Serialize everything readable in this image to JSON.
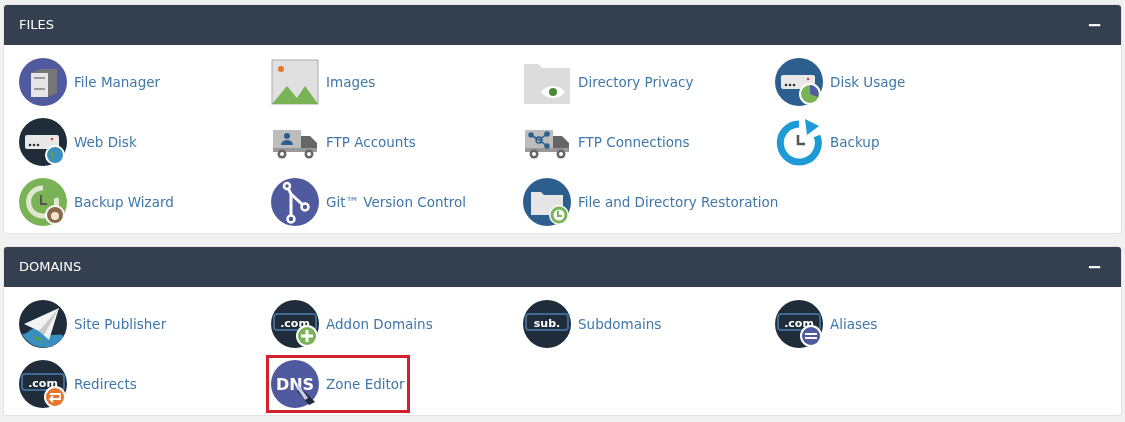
{
  "sections": [
    {
      "title": "FILES",
      "toggle_label": "−",
      "items": [
        {
          "label": "File Manager",
          "kind": "cabinet",
          "highlighted": false
        },
        {
          "label": "Images",
          "kind": "picture",
          "highlighted": false
        },
        {
          "label": "Directory Privacy",
          "kind": "folder-eye",
          "highlighted": false
        },
        {
          "label": "Disk Usage",
          "kind": "server-pie",
          "highlighted": false
        },
        {
          "label": "Web Disk",
          "kind": "server-globe",
          "highlighted": false
        },
        {
          "label": "FTP Accounts",
          "kind": "truck-person",
          "highlighted": false
        },
        {
          "label": "FTP Connections",
          "kind": "truck-network",
          "highlighted": false
        },
        {
          "label": "Backup",
          "kind": "backup",
          "highlighted": false
        },
        {
          "label": "Backup Wizard",
          "kind": "backup-wizard",
          "highlighted": false
        },
        {
          "label": "Git™ Version Control",
          "kind": "git",
          "highlighted": false
        },
        {
          "label": "File and Directory Restoration",
          "kind": "folder-restore",
          "highlighted": false
        }
      ]
    },
    {
      "title": "DOMAINS",
      "toggle_label": "−",
      "items": [
        {
          "label": "Site Publisher",
          "kind": "plane",
          "highlighted": false
        },
        {
          "label": "Addon Domains",
          "kind": "domain-plus",
          "icon_text": ".com",
          "highlighted": false
        },
        {
          "label": "Subdomains",
          "kind": "domain",
          "icon_text": "sub.",
          "highlighted": false
        },
        {
          "label": "Aliases",
          "kind": "domain-minus",
          "icon_text": ".com",
          "highlighted": false
        },
        {
          "label": "Redirects",
          "kind": "domain-redirect",
          "icon_text": ".com",
          "highlighted": false
        },
        {
          "label": "Zone Editor",
          "kind": "dns",
          "icon_text": "DNS",
          "highlighted": true
        }
      ]
    }
  ]
}
